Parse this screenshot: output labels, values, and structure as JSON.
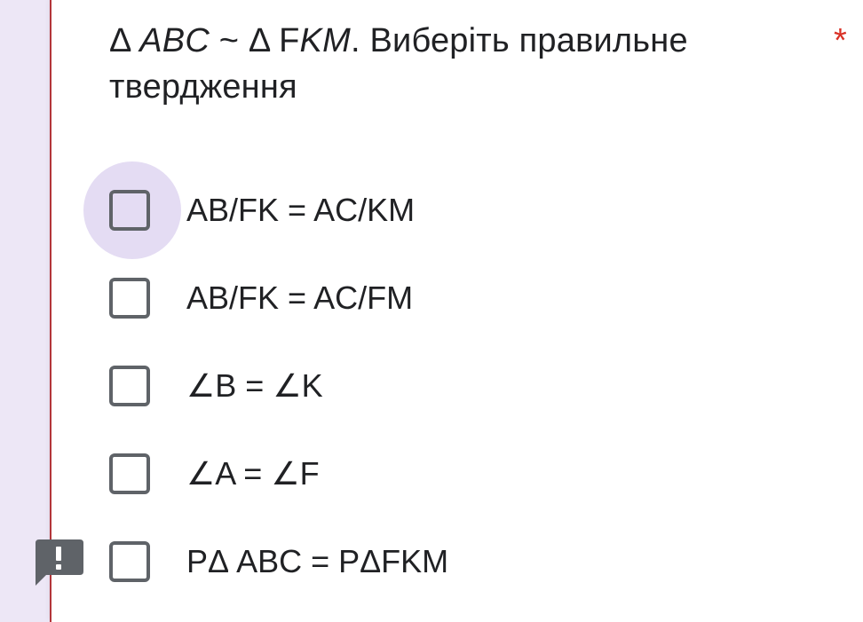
{
  "question": {
    "prefix_delta": "Δ ",
    "triangle1": "ABC",
    "similar": " ~ Δ F",
    "triangle2": "KM",
    "suffix": ". Виберіть правильне твердження",
    "required_mark": "*"
  },
  "options": [
    {
      "label": "AB/FK = AC/KM"
    },
    {
      "label": "AB/FK = AC/FM"
    },
    {
      "label": "∠B = ∠K"
    },
    {
      "label": "∠A = ∠F"
    },
    {
      "label": "PΔ ABC = PΔFKM"
    }
  ],
  "icons": {
    "feedback": "report-exclamation-icon"
  },
  "colors": {
    "accent_border": "#b3353a",
    "required": "#d93025",
    "background": "#ede7f6",
    "checkbox_border": "#5f6368",
    "hover": "#e4dcf3"
  }
}
